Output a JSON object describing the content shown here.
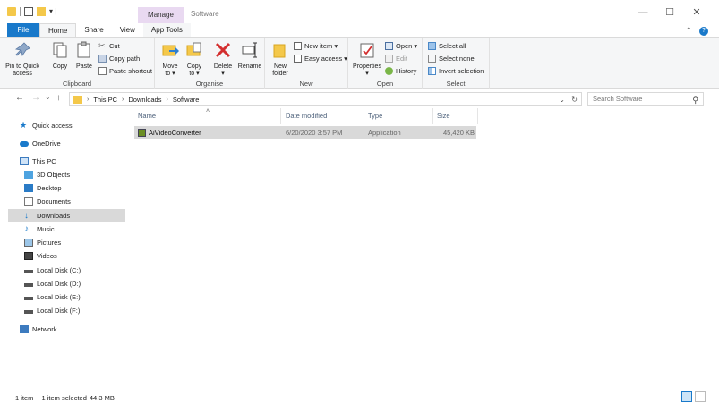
{
  "window": {
    "title": "Software",
    "context_tab": "Manage",
    "qat_dropdown": "▾ |",
    "minimize": "—",
    "maximize": "☐",
    "close": "✕"
  },
  "tabs": [
    "File",
    "Home",
    "Share",
    "View",
    "App Tools"
  ],
  "ribbon": {
    "clipboard": {
      "label": "Clipboard",
      "pin_line1": "Pin to Quick",
      "pin_line2": "access",
      "copy": "Copy",
      "paste": "Paste",
      "cut": "Cut",
      "copy_path": "Copy path",
      "paste_shortcut": "Paste shortcut"
    },
    "organise": {
      "label": "Organise",
      "move_line1": "Move",
      "move_line2": "to ▾",
      "copy_line1": "Copy",
      "copy_line2": "to ▾",
      "delete": "Delete",
      "delete_dd": "▾",
      "rename": "Rename"
    },
    "new": {
      "label": "New",
      "new_folder_line1": "New",
      "new_folder_line2": "folder",
      "new_item": "New item ▾",
      "easy_access": "Easy access ▾"
    },
    "open": {
      "label": "Open",
      "properties": "Properties",
      "properties_dd": "▾",
      "open": "Open ▾",
      "edit": "Edit",
      "history": "History"
    },
    "select": {
      "label": "Select",
      "select_all": "Select all",
      "select_none": "Select none",
      "invert": "Invert selection"
    }
  },
  "address": {
    "back": "←",
    "forward": "→",
    "recent": "⌄",
    "up": "↑",
    "chev": "›",
    "crumbs": [
      "This PC",
      "Downloads",
      "Software"
    ],
    "search_placeholder": "Search Software"
  },
  "nav": {
    "items": [
      {
        "label": "Quick access",
        "icon": "star-icon"
      },
      {
        "label": "OneDrive",
        "icon": "cloud-icon"
      },
      {
        "label": "This PC",
        "icon": "computer-icon"
      },
      {
        "label": "3D Objects",
        "icon": "cube-icon"
      },
      {
        "label": "Desktop",
        "icon": "desktop-icon"
      },
      {
        "label": "Documents",
        "icon": "document-icon"
      },
      {
        "label": "Downloads",
        "icon": "download-icon",
        "selected": true
      },
      {
        "label": "Music",
        "icon": "music-icon"
      },
      {
        "label": "Pictures",
        "icon": "picture-icon"
      },
      {
        "label": "Videos",
        "icon": "video-icon"
      },
      {
        "label": "Local Disk (C:)",
        "icon": "drive-icon"
      },
      {
        "label": "Local Disk (D:)",
        "icon": "drive-icon"
      },
      {
        "label": "Local Disk (E:)",
        "icon": "drive-icon"
      },
      {
        "label": "Local Disk (F:)",
        "icon": "drive-icon"
      },
      {
        "label": "Network",
        "icon": "network-icon"
      }
    ]
  },
  "files": {
    "columns": [
      "Name",
      "Date modified",
      "Type",
      "Size"
    ],
    "sort_indicator": "˄",
    "rows": [
      {
        "name": "AiVideoConverter",
        "date": "6/20/2020 3:57 PM",
        "type": "Application",
        "size": "45,420 KB"
      }
    ]
  },
  "status": {
    "count": "1 item",
    "selected": "1 item selected",
    "size": "44.3 MB"
  },
  "colors": {
    "accent": "#1979ca",
    "folder": "#f4c84a",
    "manage_tab": "#e9d9f1",
    "selection": "#d9d9d9"
  }
}
